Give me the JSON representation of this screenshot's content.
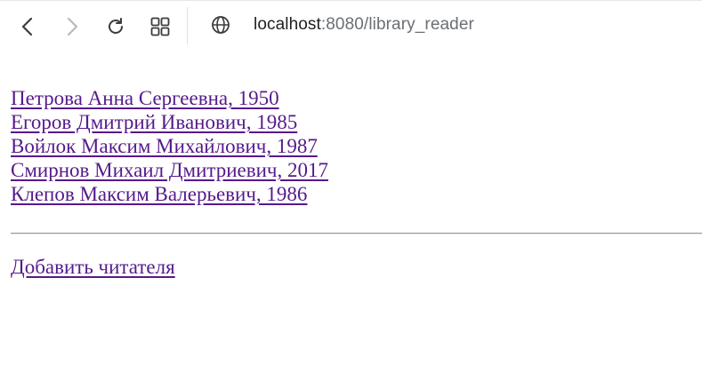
{
  "browser": {
    "address_host": "localhost",
    "address_rest": ":8080/library_reader",
    "icons": {
      "back": "chevron-left",
      "forward": "chevron-right",
      "reload": "reload",
      "apps": "grid",
      "site": "globe"
    }
  },
  "readers": [
    {
      "label": "Петрова Анна Сергеевна, 1950"
    },
    {
      "label": "Егоров Дмитрий Иванович, 1985"
    },
    {
      "label": "Войлок Максим Михайлович, 1987"
    },
    {
      "label": "Смирнов Михаил Дмитриевич, 2017"
    },
    {
      "label": "Клепов Максим Валерьевич, 1986"
    }
  ],
  "actions": {
    "add_reader": "Добавить читателя"
  },
  "colors": {
    "link_visited": "#551a8b",
    "address_host": "#1f1f1f",
    "address_rest": "#6a6f74"
  }
}
